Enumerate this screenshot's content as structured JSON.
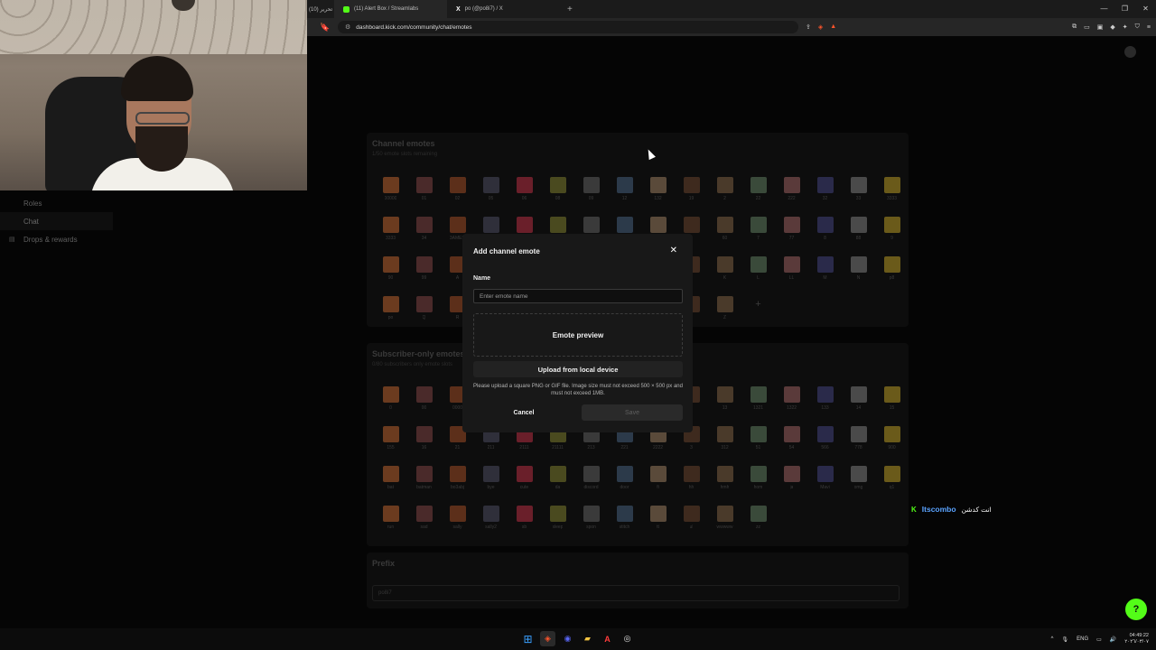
{
  "browser": {
    "tabs": [
      {
        "label": "(10) تحرير",
        "favicon": "kick-icon"
      },
      {
        "label": "(11) Alert Box / Streamlabs",
        "favicon": "streamlabs-icon"
      },
      {
        "label": "po (@po8i7) / X",
        "favicon": "x-icon"
      }
    ],
    "new_tab": "+",
    "url": "dashboard.kick.com/community/chat/emotes",
    "window_controls": [
      "—",
      "❐",
      "✕"
    ]
  },
  "sidebar": {
    "items": [
      {
        "label": "Roles",
        "active": false
      },
      {
        "label": "Chat",
        "active": true
      },
      {
        "label": "Drops & rewards",
        "active": false,
        "icon": "gift-icon"
      }
    ]
  },
  "channel_emotes": {
    "title": "Channel emotes",
    "subtitle": "1/50 emote slots remaining",
    "items": [
      "00000",
      "01",
      "02",
      "05",
      "06",
      "08",
      "09",
      "12",
      "132",
      "19",
      "2",
      "22",
      "222",
      "32",
      "33",
      "3333",
      "3333",
      "34",
      "3AMER",
      "",
      "",
      "",
      "",
      "",
      "",
      "",
      "60",
      "7",
      "77",
      "8",
      "88",
      "9",
      "90",
      "99",
      "A",
      "",
      "",
      "",
      "",
      "",
      "",
      "",
      "K",
      "L",
      "LL",
      "M",
      "N",
      "p8",
      "po",
      "Q",
      "R",
      "",
      "",
      "",
      "",
      "",
      "",
      "",
      "Z"
    ],
    "add_label": "+"
  },
  "subscriber_emotes": {
    "title": "Subscriber-only emotes",
    "subtitle": "0/80 subscribers only emote slots",
    "items": [
      "0",
      "00",
      "0000",
      "",
      "",
      "",
      "",
      "",
      "",
      "",
      "13",
      "1321",
      "1322",
      "133",
      "14",
      "15",
      "155",
      "16",
      "21",
      "211",
      "2111",
      "21111",
      "213",
      "221",
      "2222",
      "3",
      "312",
      "51",
      "54",
      "566",
      "778",
      "900",
      "bat",
      "batman",
      "bo3abj",
      "bye",
      "cute",
      "da",
      "discord",
      "door",
      "fi",
      "hh",
      "hmh",
      "hom",
      "ja",
      "Mavi",
      "omg",
      "q1",
      "run",
      "sad",
      "sally",
      "sally2",
      "sb",
      "sleep",
      "spon",
      "stitch",
      "tt",
      "ul",
      "wwwww",
      "zz"
    ]
  },
  "prefix": {
    "title": "Prefix",
    "value": "po8i7"
  },
  "modal": {
    "title": "Add channel emote",
    "name_label": "Name",
    "name_placeholder": "Enter emote name",
    "name_value": "",
    "preview_label": "Emote preview",
    "upload_label": "Upload from local device",
    "hint": "Please upload a square PNG or GIF file. Image size must not exceed 500 × 500 px and must not exceed 1MB.",
    "cancel_label": "Cancel",
    "save_label": "Save"
  },
  "chat_overlay": {
    "badge": "K",
    "username": "Itscombo",
    "message": "انت كدشن"
  },
  "taskbar": {
    "language": "ENG",
    "time": "04:49:22",
    "date": "٢٠٢٦/٠٣/٠٧"
  },
  "colors": {
    "accent": "#53fc18",
    "username": "#5aa3ff",
    "brave": "#fb542b"
  }
}
